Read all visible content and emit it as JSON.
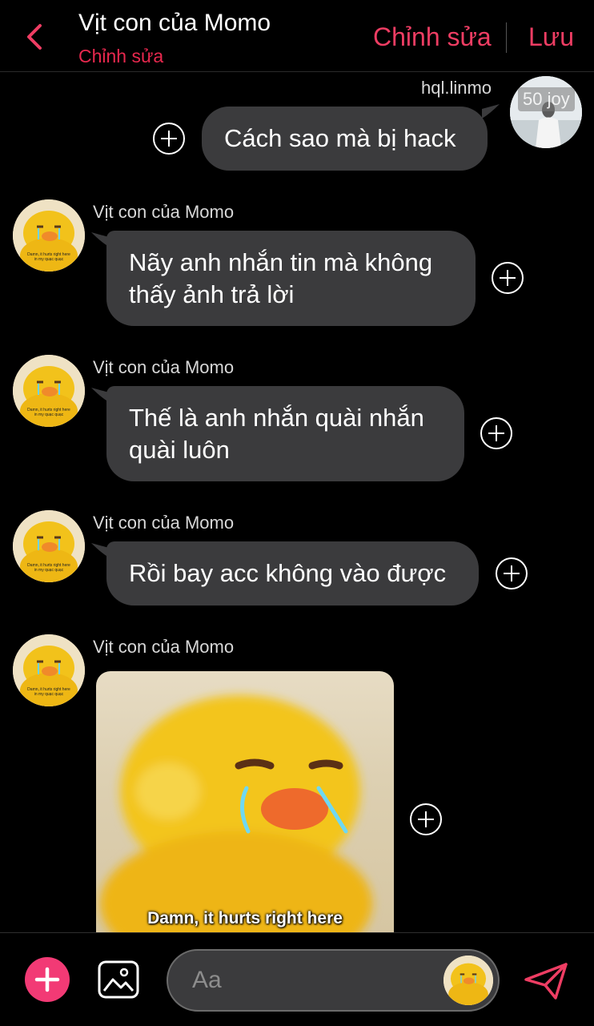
{
  "header": {
    "title": "Vịt con của Momo",
    "subtitle": "Chỉnh sửa",
    "edit_label": "Chỉnh sửa",
    "save_label": "Lưu"
  },
  "me": {
    "username": "hql.linmo",
    "avatar_text": "50 joy"
  },
  "messages": [
    {
      "from": "me",
      "text": "Cách sao mà bị hack"
    },
    {
      "from": "other",
      "sender": "Vịt con của Momo",
      "lines": [
        "Nãy anh nhắn tin mà không",
        "thấy ảnh trả lời"
      ]
    },
    {
      "from": "other",
      "sender": "Vịt con của Momo",
      "lines": [
        "Thế là anh nhắn quài nhắn",
        "quài luôn"
      ]
    },
    {
      "from": "other",
      "sender": "Vịt con của Momo",
      "lines": [
        "Rồi bay acc không vào được"
      ]
    },
    {
      "from": "other",
      "sender": "Vịt con của Momo",
      "image_caption": "Damn, it hurts right here"
    }
  ],
  "avatar_caption": [
    "Damn, it hurts right here",
    "in my quạc quạc"
  ],
  "composer": {
    "placeholder": "Aa"
  },
  "colors": {
    "accent": "#ee3d63",
    "bubble": "#3b3b3d",
    "background": "#000000"
  },
  "icons": [
    "back-arrow-icon",
    "plus-circle-icon",
    "add-icon",
    "image-icon",
    "send-icon"
  ]
}
